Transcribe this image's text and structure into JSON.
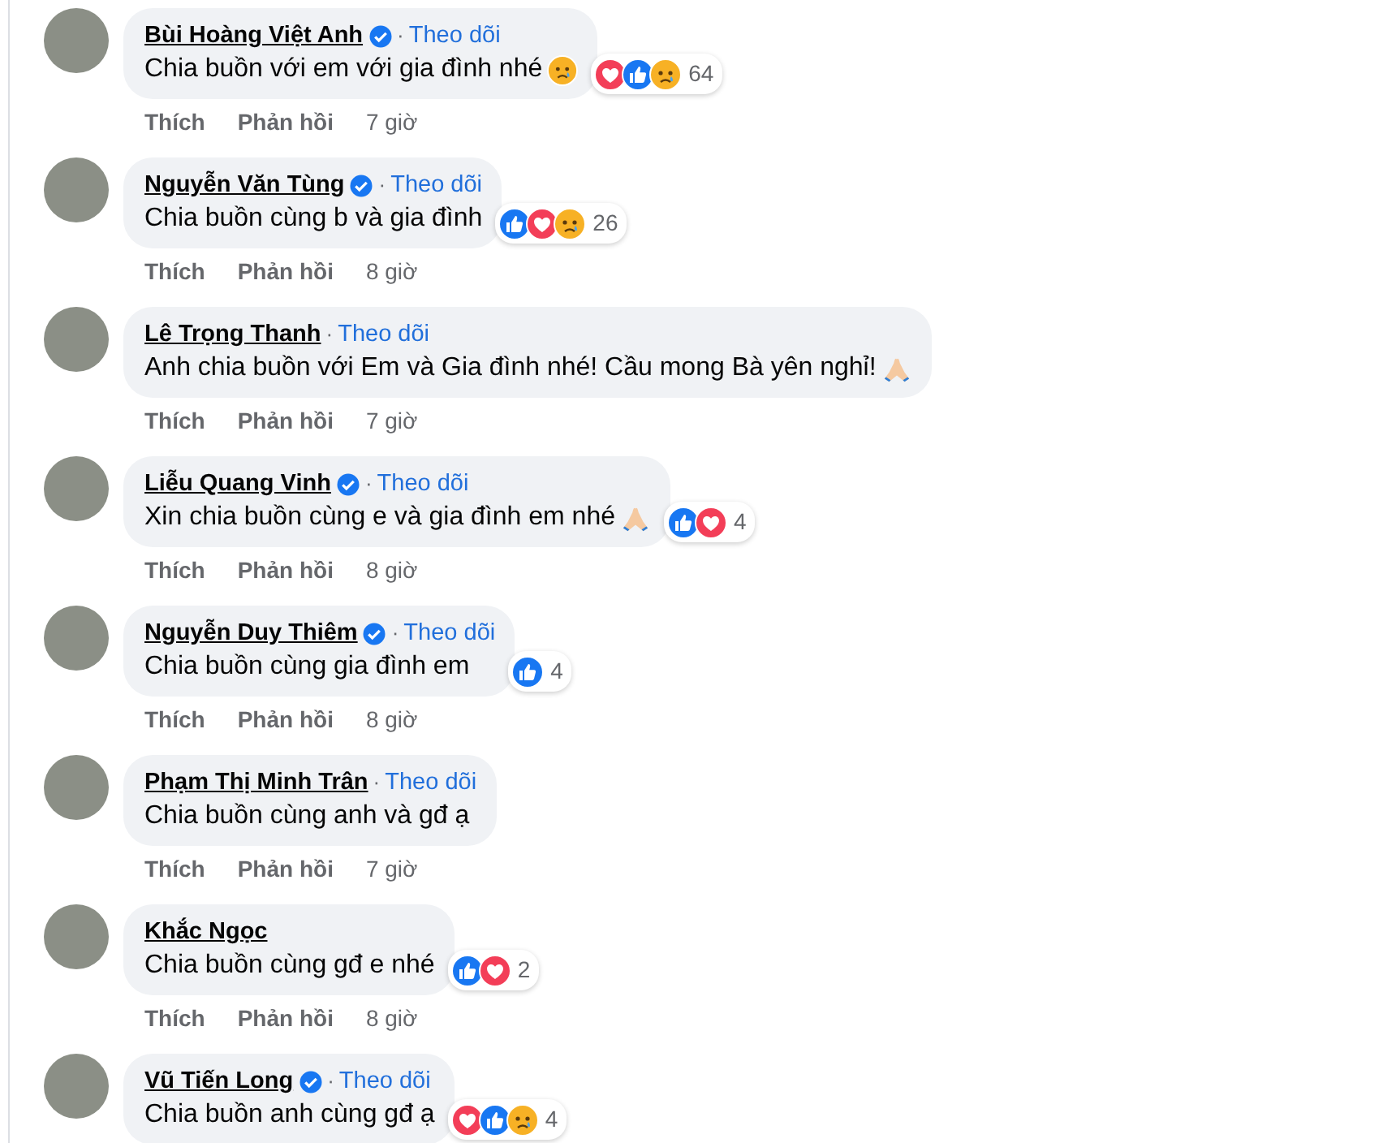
{
  "comments": [
    {
      "author": "Bùi Hoàng Việt Anh",
      "verified": true,
      "follow_separator": "·",
      "follow_label": "Theo dõi",
      "text": "Chia buồn với em với gia đình nhé",
      "emoji": {
        "kind": "sad"
      },
      "reactions": {
        "icons": [
          {
            "kind": "love"
          },
          {
            "kind": "like"
          },
          {
            "kind": "sad"
          }
        ],
        "count": "64"
      },
      "like_label": "Thích",
      "reply_label": "Phản hồi",
      "time": "7 giờ"
    },
    {
      "author": "Nguyễn Văn Tùng",
      "verified": true,
      "follow_separator": "·",
      "follow_label": "Theo dõi",
      "text": "Chia buồn cùng b và gia đình",
      "reactions": {
        "icons": [
          {
            "kind": "like"
          },
          {
            "kind": "love"
          },
          {
            "kind": "sad"
          }
        ],
        "count": "26"
      },
      "like_label": "Thích",
      "reply_label": "Phản hồi",
      "time": "8 giờ"
    },
    {
      "author": "Lê Trọng Thanh",
      "verified": false,
      "follow_separator": "·",
      "follow_label": "Theo dõi",
      "text": "Anh chia buồn với Em và Gia đình nhé! Cầu mong Bà yên nghỉ!",
      "emoji": {
        "kind": "pray"
      },
      "like_label": "Thích",
      "reply_label": "Phản hồi",
      "time": "7 giờ"
    },
    {
      "author": "Liễu Quang Vinh",
      "verified": true,
      "follow_separator": "·",
      "follow_label": "Theo dõi",
      "text": "Xin chia buồn cùng e và gia đình em nhé",
      "emoji": {
        "kind": "pray"
      },
      "reactions": {
        "icons": [
          {
            "kind": "like"
          },
          {
            "kind": "love"
          }
        ],
        "count": "4"
      },
      "like_label": "Thích",
      "reply_label": "Phản hồi",
      "time": "8 giờ"
    },
    {
      "author": "Nguyễn Duy Thiêm",
      "verified": true,
      "follow_separator": "·",
      "follow_label": "Theo dõi",
      "text": "Chia buồn cùng gia đình em",
      "reactions": {
        "icons": [
          {
            "kind": "like"
          }
        ],
        "count": "4"
      },
      "like_label": "Thích",
      "reply_label": "Phản hồi",
      "time": "8 giờ"
    },
    {
      "author": "Phạm Thị Minh Trân",
      "verified": false,
      "follow_separator": "·",
      "follow_label": "Theo dõi",
      "text": "Chia buồn cùng anh và gđ ạ",
      "like_label": "Thích",
      "reply_label": "Phản hồi",
      "time": "7 giờ"
    },
    {
      "author": "Khắc Ngọc",
      "verified": false,
      "text": "Chia buồn cùng gđ e nhé",
      "reactions": {
        "icons": [
          {
            "kind": "like"
          },
          {
            "kind": "love"
          }
        ],
        "count": "2"
      },
      "like_label": "Thích",
      "reply_label": "Phản hồi",
      "time": "8 giờ"
    },
    {
      "author": "Vũ Tiến Long",
      "verified": true,
      "follow_separator": "·",
      "follow_label": "Theo dõi",
      "text": "Chia buồn anh cùng gđ ạ",
      "reactions": {
        "icons": [
          {
            "kind": "love"
          },
          {
            "kind": "like"
          },
          {
            "kind": "sad"
          }
        ],
        "count": "4"
      }
    }
  ]
}
